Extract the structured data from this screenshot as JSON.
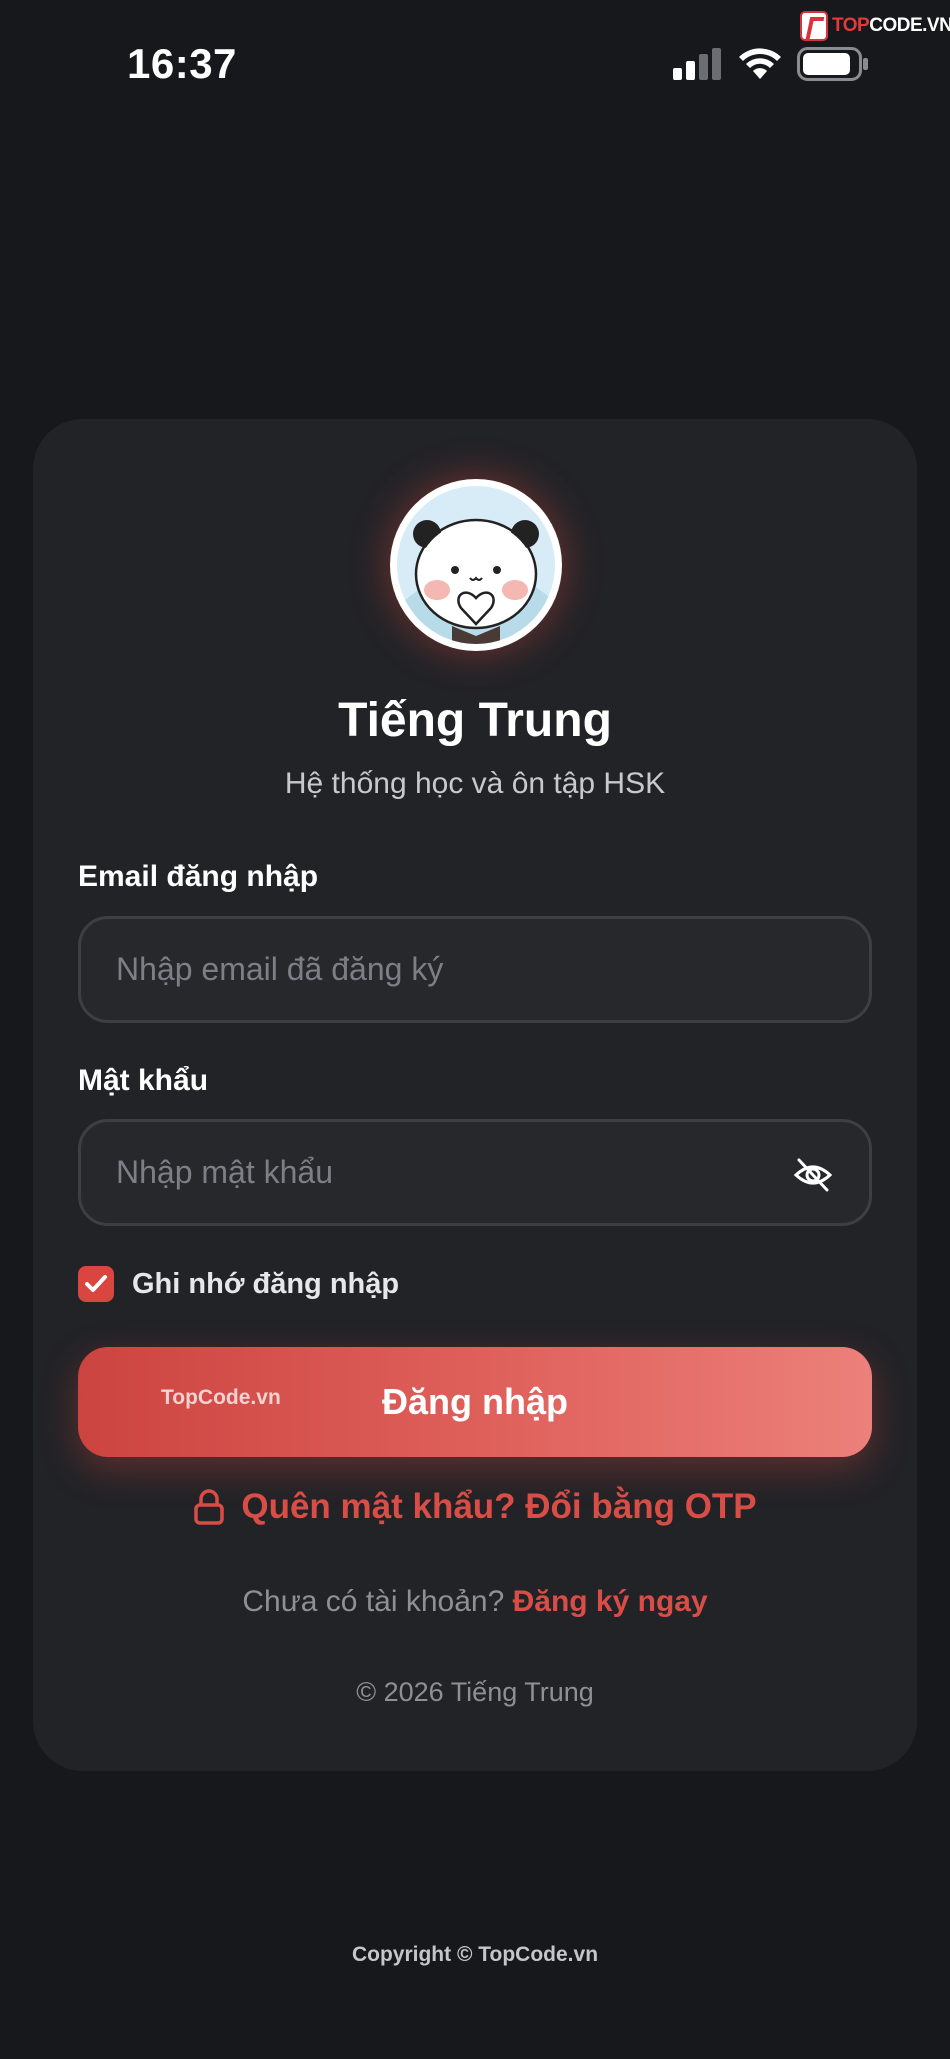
{
  "status_bar": {
    "time": "16:37",
    "watermark_brand": "TOP",
    "watermark_domain": "CODE.VN"
  },
  "card": {
    "title": "Tiếng Trung",
    "subtitle": "Hệ thống học và ôn tập HSK",
    "email_label": "Email đăng nhập",
    "email_placeholder": "Nhập email đã đăng ký",
    "email_value": "",
    "password_label": "Mật khẩu",
    "password_placeholder": "Nhập mật khẩu",
    "password_value": "",
    "remember_label": "Ghi nhớ đăng nhập",
    "remember_checked": true,
    "login_button": "Đăng nhập",
    "button_watermark": "TopCode.vn",
    "forgot_label": "Quên mật khẩu? Đổi bằng OTP",
    "signup_prompt": "Chưa có tài khoản?",
    "signup_link": "Đăng ký ngay",
    "copyright": "© 2026 Tiếng Trung"
  },
  "footer": {
    "copyright": "Copyright © TopCode.vn"
  },
  "icons": {
    "password_toggle": "eye-off-icon",
    "forgot": "lock-icon",
    "remember": "check-icon"
  },
  "colors": {
    "background": "#17181b",
    "card": "#222327",
    "accent": "#d94d47",
    "button_start": "#cc4440",
    "button_end": "#ec807a"
  }
}
